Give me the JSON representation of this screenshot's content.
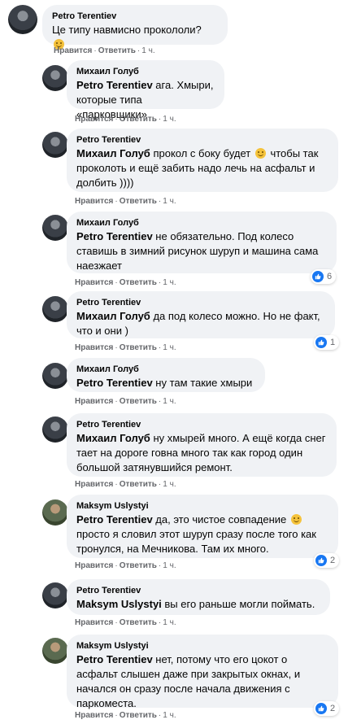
{
  "actions": {
    "like": "Нравится",
    "reply": "Ответить",
    "dot": "·"
  },
  "colors": {
    "bubble": "#f0f2f5",
    "accent": "#1877f2",
    "meta": "#65676b"
  },
  "comments": [
    {
      "author": "Petro Terentiev",
      "mention": "",
      "text": "Це типу навмисно прокололи?",
      "emoji": "thinking-face",
      "time": "1 ч.",
      "reaction_count": ""
    },
    {
      "author": "Михаил Голуб",
      "mention": "Petro Terentiev",
      "text": " ага. Хмыри, которые типа «парковщики»",
      "time": "1 ч.",
      "reaction_count": ""
    },
    {
      "author": "Petro Terentiev",
      "mention": "Михаил Голуб",
      "text": " прокол с боку будет",
      "emoji": "smiling-face",
      "text2": " чтобы так проколоть и ещё забить надо лечь на асфальт и долбить ))))",
      "time": "1 ч.",
      "reaction_count": ""
    },
    {
      "author": "Михаил Голуб",
      "mention": "Petro Terentiev",
      "text": " не обязательно. Под колесо ставишь в зимний рисунок шуруп и машина сама наезжает",
      "time": "1 ч.",
      "reaction_count": "6"
    },
    {
      "author": "Petro Terentiev",
      "mention": "Михаил Голуб",
      "text": " да под колесо можно. Но не факт, что и они )",
      "time": "1 ч.",
      "reaction_count": "1"
    },
    {
      "author": "Михаил Голуб",
      "mention": "Petro Terentiev",
      "text": " ну там такие хмыри",
      "time": "1 ч.",
      "reaction_count": ""
    },
    {
      "author": "Petro Terentiev",
      "mention": "Михаил Голуб",
      "text": " ну хмырей много. А ещё когда снег тает на дороге говна много так как город один большой затянувшийся ремонт.",
      "time": "1 ч.",
      "reaction_count": ""
    },
    {
      "author": "Maksym Uslystyi",
      "mention": "Petro Terentiev",
      "text": " да, это чистое совпадение",
      "emoji": "smiling-face",
      "text2": " просто я словил этот шуруп сразу после того как тронулся, на Мечникова. Там их много.",
      "time": "1 ч.",
      "reaction_count": "2"
    },
    {
      "author": "Petro Terentiev",
      "mention": "Maksym Uslystyi",
      "text": " вы его раньше могли поймать.",
      "time": "1 ч.",
      "reaction_count": ""
    },
    {
      "author": "Maksym Uslystyi",
      "mention": "Petro Terentiev",
      "text": " нет, потому что его цокот о асфальт слышен даже при закрытых окнах, и начался он сразу после начала движения с паркоместа.",
      "time": "1 ч.",
      "reaction_count": "2"
    }
  ]
}
